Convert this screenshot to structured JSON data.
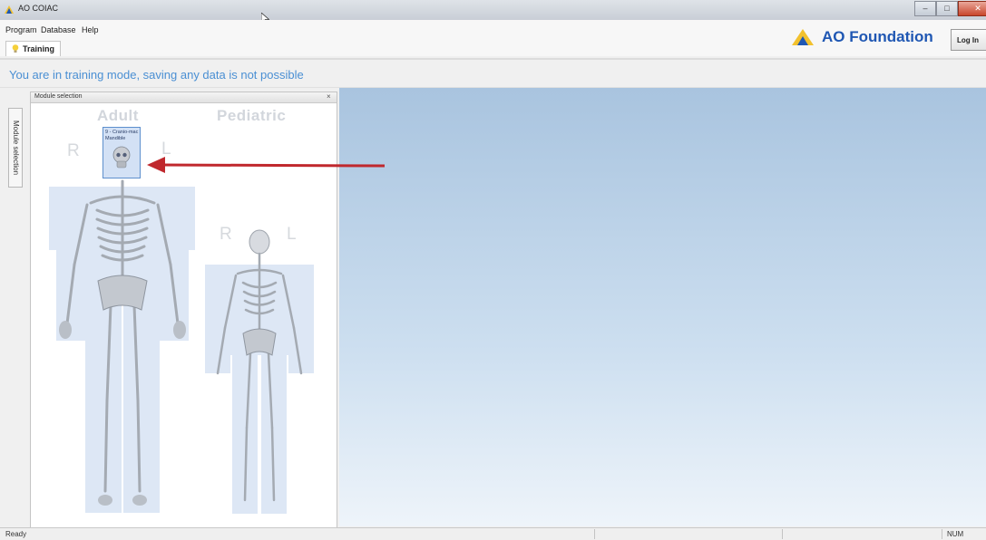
{
  "window": {
    "title": "AO COIAC"
  },
  "menu": {
    "items": [
      "Program",
      "Database",
      "Help"
    ]
  },
  "tabs": {
    "training_label": "Training"
  },
  "brand": {
    "logo_text": "AO Foundation",
    "color": "#1f57b3"
  },
  "header": {
    "login_label": "Log In"
  },
  "banner": {
    "text": "You are in training mode, saving any data is not possible",
    "color": "#4a8fd3"
  },
  "side_tab": {
    "label": "Module selection"
  },
  "panel": {
    "title": "Module selection",
    "close_glyph": "×",
    "adult_label": "Adult",
    "pediatric_label": "Pediatric",
    "right_letter": "R",
    "left_letter": "L",
    "selected_module_text": "9 - Cranio-mac Mandible"
  },
  "status": {
    "ready": "Ready",
    "num": "NUM"
  },
  "colors": {
    "viewer_top": "#a9c4df",
    "viewer_bottom": "#eef4fa",
    "arrow": "#c0282d"
  }
}
